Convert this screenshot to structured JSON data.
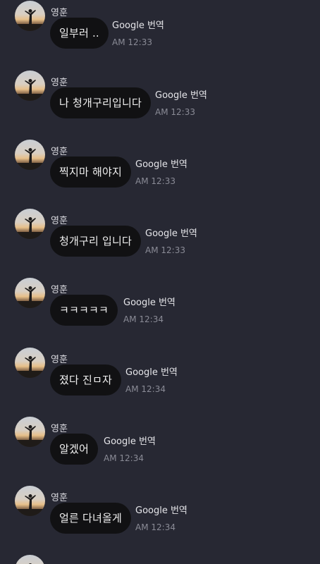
{
  "sender": "영훈",
  "translate_label": "Google 번역",
  "messages": [
    {
      "text": "일부러 ..",
      "time": "AM 12:33"
    },
    {
      "text": "나 청개구리입니다",
      "time": "AM 12:33"
    },
    {
      "text": "찍지마 해야지",
      "time": "AM 12:33"
    },
    {
      "text": "청개구리 입니다",
      "time": "AM 12:33"
    },
    {
      "text": "ㅋㅋㅋㅋㅋ",
      "time": "AM 12:34"
    },
    {
      "text": "졌다 진ㅁ자",
      "time": "AM 12:34"
    },
    {
      "text": "알겠어",
      "time": "AM 12:34"
    },
    {
      "text": "얼른 다녀올게",
      "time": "AM 12:34"
    }
  ],
  "colors": {
    "background": "#272833",
    "bubble": "#111113",
    "time": "#8a8b96"
  }
}
